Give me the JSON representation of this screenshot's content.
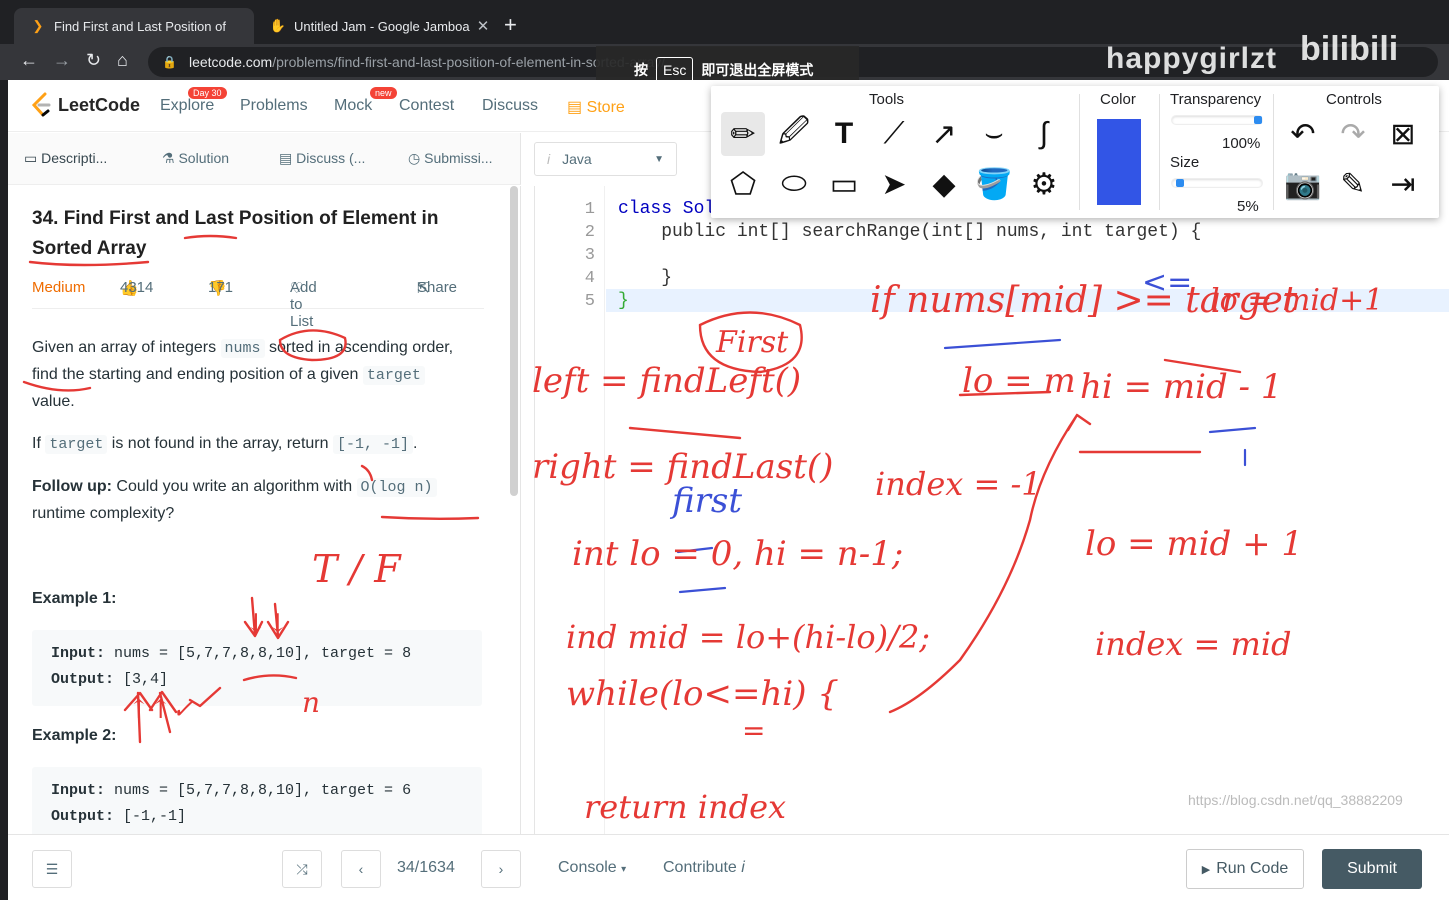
{
  "browser": {
    "tabs": [
      {
        "title": "Find First and Last Position of",
        "active": true
      },
      {
        "title": "Untitled Jam - Google Jamboa",
        "active": false
      }
    ],
    "url_domain": "leetcode.com",
    "url_path": "/problems/find-first-and-last-position-of-element-in-sorted-array/",
    "exit_fullscreen": {
      "pre": "按",
      "key": "Esc",
      "post": "即可退出全屏模式"
    },
    "watermark": "happygirlzt",
    "watermark2": "bilibili"
  },
  "leetcode": {
    "logo": "LeetCode",
    "nav": [
      {
        "label": "Explore",
        "badge": "Day 30"
      },
      {
        "label": "Problems"
      },
      {
        "label": "Mock",
        "badge": "new"
      },
      {
        "label": "Contest"
      },
      {
        "label": "Discuss"
      },
      {
        "label": "Store"
      }
    ],
    "left_tabs": [
      "Descripti...",
      "Solution",
      "Discuss (...",
      "Submissi..."
    ],
    "problem": {
      "title": "34. Find First and Last Position of Element in Sorted Array",
      "difficulty": "Medium",
      "likes": "4314",
      "dislikes": "171",
      "add_to_list": "Add to List",
      "share": "Share",
      "p1_a": "Given an array of integers ",
      "p1_code": "nums",
      "p1_b": " sorted in ascending order, find the starting and ending position of a given ",
      "p1_code2": "target",
      "p1_c": " value.",
      "p2_a": "If ",
      "p2_code": "target",
      "p2_b": " is not found in the array, return ",
      "p2_code2": "[-1, -1]",
      "p2_c": ".",
      "p3_bold": "Follow up:",
      "p3_a": " Could you write an algorithm with ",
      "p3_code": "O(log n)",
      "p3_b": " runtime complexity?",
      "ex1_title": "Example 1:",
      "ex1_in_label": "Input:",
      "ex1_in": " nums = [5,7,7,8,8,10], target = 8",
      "ex1_out_label": "Output:",
      "ex1_out": " [3,4]",
      "ex2_title": "Example 2:",
      "ex2_in_label": "Input:",
      "ex2_in": " nums = [5,7,7,8,8,10], target = 6",
      "ex2_out_label": "Output:",
      "ex2_out": " [-1,-1]"
    },
    "language": "Java",
    "code_lines": [
      {
        "n": "1",
        "text": "class Sol"
      },
      {
        "n": "2",
        "text": "    public int[] searchRange(int[] nums, int target) {"
      },
      {
        "n": "3",
        "text": ""
      },
      {
        "n": "4",
        "text": "    }"
      },
      {
        "n": "5",
        "text": "}"
      }
    ],
    "pager": "34/1634",
    "console": "Console",
    "contribute": "Contribute",
    "run_code": "Run Code",
    "submit": "Submit",
    "footer_watermark": "https://blog.csdn.net/qq_38882209"
  },
  "jamboard": {
    "headers": {
      "tools": "Tools",
      "color": "Color",
      "transparency": "Transparency",
      "size": "Size",
      "controls": "Controls"
    },
    "transparency_pct": "100%",
    "size_pct": "5%",
    "transparency_value": 1.0,
    "size_value": 0.05,
    "color": "#3255e6"
  },
  "annotations": {
    "red_texts": [
      "First",
      "left = findLeft()",
      "right = findLast()",
      "int lo = 0, hi = n-1;",
      "ind mid = lo+(hi-lo)/2;",
      "while(lo<=hi) {",
      "return index",
      "T / F",
      "if nums[mid] >= target",
      "lo = mid+1",
      "lo = m",
      "hi = mid - 1",
      "index = -1",
      "lo = mid + 1",
      "index = mid",
      "n",
      "=",
      "↓↓",
      "↑↑✓"
    ],
    "blue_texts": [
      "first",
      "<="
    ]
  }
}
